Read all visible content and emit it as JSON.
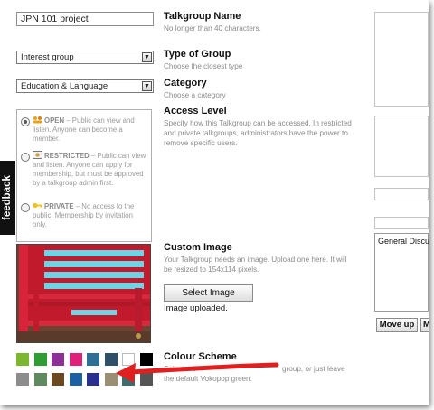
{
  "form": {
    "name_value": "JPN 101 project",
    "name_title": "Talkgroup Name",
    "name_hint": "No longer than 40 characters.",
    "type_value": "Interest group",
    "type_title": "Type of Group",
    "type_hint": "Choose the closest type",
    "category_value": "Education & Language",
    "category_title": "Category",
    "category_hint": "Choose a category",
    "access_title": "Access Level",
    "access_hint": "Specify how this Talkgroup can be accessed. In restricted and private talkgroups, administrators have the power to remove specific users.",
    "access_options": [
      {
        "name": "OPEN",
        "desc": " – Public can view and listen. Anyone can become a member.",
        "selected": true,
        "icon": "group-icon"
      },
      {
        "name": "RESTRICTED",
        "desc": " – Public can view and listen. Anyone can apply for membership, but must be approved by a talkgroup admin first.",
        "selected": false,
        "icon": "restricted-icon"
      },
      {
        "name": "PRIVATE",
        "desc": " – No access to the public. Membership by invitation only.",
        "selected": false,
        "icon": "key-icon"
      }
    ],
    "image_title": "Custom Image",
    "image_hint": "Your Talkgroup needs an image. Upload one here. It will be resized to 154x114 pixels.",
    "select_image_label": "Select Image",
    "image_status": "Image uploaded.",
    "colour_title": "Colour Scheme",
    "colour_hint_pre": "Select a c",
    "colour_hint_post": "group, or just leave",
    "colour_hint_line2": "the default Vokopop green.",
    "swatches_row1": [
      "#7cb82f",
      "#2f9d34",
      "#8e2f97",
      "#e01f7a",
      "#2e6f95",
      "#2f4e68",
      "#ffffff",
      "#000000"
    ],
    "swatches_row2": [
      "#8c8c8c",
      "#5f8a5f",
      "#6b4a22",
      "#1d5fa5",
      "#2b2f8f",
      "#9a8f74",
      "#3d6c6c",
      "#555555"
    ]
  },
  "feedback_label": "feedback",
  "right": {
    "list_item": "General Discus",
    "move_up_label": "Move up",
    "move_down_label": "Mo"
  },
  "colors": {
    "annotation_arrow": "#e02020"
  }
}
